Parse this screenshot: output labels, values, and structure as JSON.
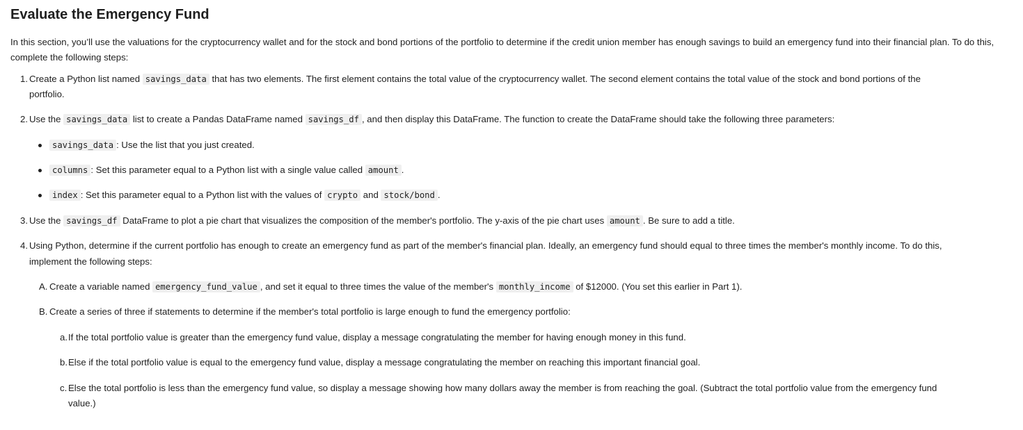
{
  "title": "Evaluate the Emergency Fund",
  "intro": "In this section, you’ll use the valuations for the cryptocurrency wallet and for the stock and bond portions of the portfolio to determine if the credit union member has enough savings to build an emergency fund into their financial plan. To do this, complete the following steps:",
  "steps": {
    "s1": {
      "num": "1.",
      "t1": "Create a Python list named ",
      "c1": "savings_data",
      "t2": " that has two elements. The first element contains the total value of the cryptocurrency wallet. The second element contains the total value of the stock and bond portions of the",
      "t3": "portfolio."
    },
    "s2": {
      "num": "2.",
      "t1": "Use the ",
      "c1": "savings_data",
      "t2": " list to create a Pandas DataFrame named ",
      "c2": "savings_df",
      "t3": ", and then display this DataFrame. The function to create the DataFrame should take the following three parameters:"
    },
    "params": {
      "p1": {
        "c1": "savings_data",
        "t1": ": Use the list that you just created."
      },
      "p2": {
        "c1": "columns",
        "t1": ": Set this parameter equal to a Python list with a single value called ",
        "c2": "amount",
        "t2": "."
      },
      "p3": {
        "c1": "index",
        "t1": ": Set this parameter equal to a Python list with the values of ",
        "c2": "crypto",
        "t2": " and ",
        "c3": "stock/bond",
        "t3": "."
      }
    },
    "s3": {
      "num": "3.",
      "t1": "Use the ",
      "c1": "savings_df",
      "t2": " DataFrame to plot a pie chart that visualizes the composition of the member's portfolio. The y-axis of the pie chart uses ",
      "c2": "amount",
      "t3": ". Be sure to add a title."
    },
    "s4": {
      "num": "4.",
      "t1": "Using Python, determine if the current portfolio has enough to create an emergency fund as part of the member's financial plan. Ideally, an emergency fund should equal to three times the member's monthly income. To do this,",
      "t2": "implement the following steps:"
    },
    "subA": {
      "label": "A.",
      "t1": "Create a variable named ",
      "c1": "emergency_fund_value",
      "t2": ", and set it equal to three times the value of the member's ",
      "c2": "monthly_income",
      "t3": " of $12000. (You set this earlier in Part 1)."
    },
    "subB": {
      "label": "B.",
      "t1": "Create a series of three if statements to determine if the member's total portfolio is large enough to fund the emergency portfolio:"
    },
    "ca": {
      "label": "a.",
      "t1": "If the total portfolio value is greater than the emergency fund value, display a message congratulating the member for having enough money in this fund."
    },
    "cb": {
      "label": "b.",
      "t1": "Else if the total portfolio value is equal to the emergency fund value, display a message congratulating the member on reaching this important financial goal."
    },
    "cc": {
      "label": "c.",
      "t1": "Else the total portfolio is less than the emergency fund value, so display a message showing how many dollars away the member is from reaching the goal. (Subtract the total portfolio value from the emergency fund",
      "t2": "value.)"
    }
  }
}
